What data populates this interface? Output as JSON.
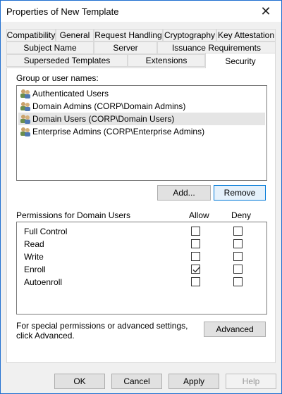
{
  "window": {
    "title": "Properties of New Template"
  },
  "tabs": {
    "row1": [
      "Compatibility",
      "General",
      "Request Handling",
      "Cryptography",
      "Key Attestation"
    ],
    "row2": [
      "Subject Name",
      "Server",
      "Issuance Requirements"
    ],
    "row3": [
      "Superseded Templates",
      "Extensions",
      "Security"
    ],
    "active": "Security"
  },
  "security": {
    "group_label": "Group or user names:",
    "users": [
      "Authenticated Users",
      "Domain Admins (CORP\\Domain Admins)",
      "Domain Users (CORP\\Domain Users)",
      "Enterprise Admins (CORP\\Enterprise Admins)"
    ],
    "selected_user_index": 2,
    "add_button": "Add...",
    "remove_button": "Remove",
    "permissions_label": "Permissions for Domain Users",
    "allow_header": "Allow",
    "deny_header": "Deny",
    "permissions": [
      {
        "name": "Full Control",
        "allow": false,
        "deny": false
      },
      {
        "name": "Read",
        "allow": false,
        "deny": false
      },
      {
        "name": "Write",
        "allow": false,
        "deny": false
      },
      {
        "name": "Enroll",
        "allow": true,
        "deny": false
      },
      {
        "name": "Autoenroll",
        "allow": false,
        "deny": false
      }
    ],
    "advanced_text": "For special permissions or advanced settings, click Advanced.",
    "advanced_button": "Advanced"
  },
  "footer": {
    "ok": "OK",
    "cancel": "Cancel",
    "apply": "Apply",
    "help": "Help"
  }
}
